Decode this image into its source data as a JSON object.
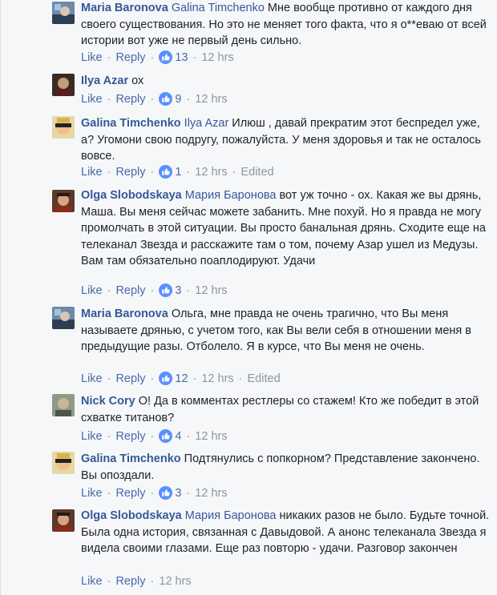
{
  "separator": "·",
  "comments": [
    {
      "author": "Maria Baronova",
      "avatar_icon": "maria-avatar-icon",
      "mention": "Galina Timchenko",
      "text": " Мне вообще противно от каждого дня своего существования. Но это не меняет того факта, что я о**еваю от всей истории вот уже не первый день сильно.",
      "like": "Like",
      "reply": "Reply",
      "reactions": "13",
      "time": "12 hrs",
      "edited": ""
    },
    {
      "author": "Ilya Azar",
      "avatar_icon": "ilya-avatar-icon",
      "mention": "",
      "text": " ох",
      "like": "Like",
      "reply": "Reply",
      "reactions": "9",
      "time": "12 hrs",
      "edited": ""
    },
    {
      "author": "Galina Timchenko",
      "avatar_icon": "galina-avatar-icon",
      "mention": "Ilya Azar",
      "text": " Илюш , давай прекратим этот беспредел уже, а? Угомони свою подругу, пожалуйста. У меня здоровья и так не осталось вовсе.",
      "like": "Like",
      "reply": "Reply",
      "reactions": "1",
      "time": "12 hrs",
      "edited": "Edited"
    },
    {
      "author": "Olga Slobodskaya",
      "avatar_icon": "olga-avatar-icon",
      "mention": "Мария Баронова",
      "text": " вот уж точно - ох. Какая же вы дрянь, Маша. Вы меня сейчас можете забанить. Мне похуй. Но я правда не могу промолчать в этой ситуации. Вы просто банальная дрянь. Сходите еще на телеканал Звезда и расскажите там о том, почему Азар ушел из Медузы. Вам там обязательно поаплодируют. Удачи",
      "like": "Like",
      "reply": "Reply",
      "reactions": "3",
      "time": "12 hrs",
      "edited": ""
    },
    {
      "author": "Maria Baronova",
      "avatar_icon": "maria-avatar-icon",
      "mention": "",
      "text": " Ольга, мне правда не очень трагично, что Вы меня называете дрянью, с учетом того, как Вы вели себя в отношении меня в предыдущие разы. Отболело. Я в курсе, что Вы меня не очень.",
      "like": "Like",
      "reply": "Reply",
      "reactions": "12",
      "time": "12 hrs",
      "edited": "Edited"
    },
    {
      "author": "Nick Cory",
      "avatar_icon": "nick-avatar-icon",
      "mention": "",
      "text": " О! Да в комментах рестлеры со стажем! Кто же победит в этой схватке титанов?",
      "like": "Like",
      "reply": "Reply",
      "reactions": "4",
      "time": "12 hrs",
      "edited": ""
    },
    {
      "author": "Galina Timchenko",
      "avatar_icon": "galina-avatar-icon",
      "mention": "",
      "text": " Подтянулись с попкорном? Представление закончено. Вы опоздали.",
      "like": "Like",
      "reply": "Reply",
      "reactions": "3",
      "time": "12 hrs",
      "edited": ""
    },
    {
      "author": "Olga Slobodskaya",
      "avatar_icon": "olga-avatar-icon",
      "mention": "Мария Баронова",
      "text": " никаких разов не было. Будьте точной. Была одна история, связанная с Давыдовой. А анонс телеканала Звезда я видела своими глазами. Еще раз повторю - удачи. Разговор закончен",
      "like": "Like",
      "reply": "Reply",
      "reactions": "",
      "time": "12 hrs",
      "edited": ""
    }
  ],
  "colors": {
    "link": "#365899",
    "meta": "#90949c",
    "background": "#f6f7f9",
    "like_blue": "#5890ff"
  }
}
